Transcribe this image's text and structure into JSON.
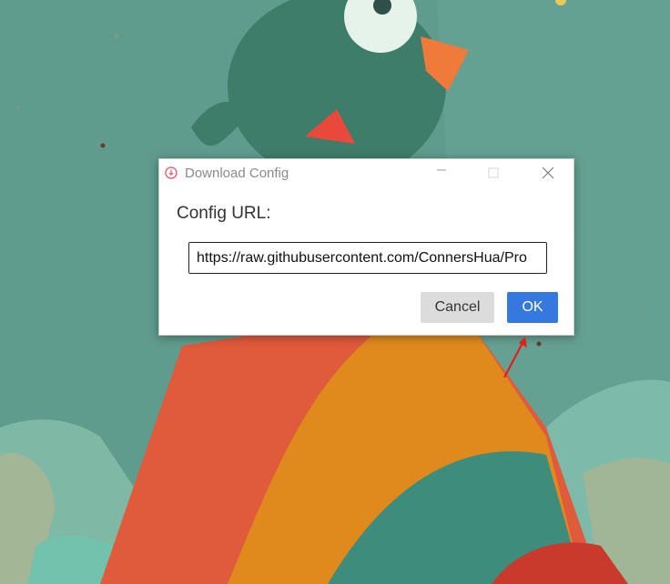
{
  "dialog": {
    "title": "Download Config",
    "app_icon": "download-circle-icon",
    "controls": {
      "minimize_icon": "minimize-icon",
      "maximize_icon": "maximize-icon",
      "close_icon": "close-icon"
    },
    "field_label": "Config URL:",
    "url_value": "https://raw.githubusercontent.com/ConnersHua/Pro",
    "cancel_label": "Cancel",
    "ok_label": "OK"
  },
  "colors": {
    "background": "#5f9c8e",
    "ok_button": "#3478e0",
    "cancel_button": "#dcdcdc",
    "annotation_arrow": "#e0201e"
  },
  "annotation": {
    "icon": "red-arrow-icon"
  }
}
